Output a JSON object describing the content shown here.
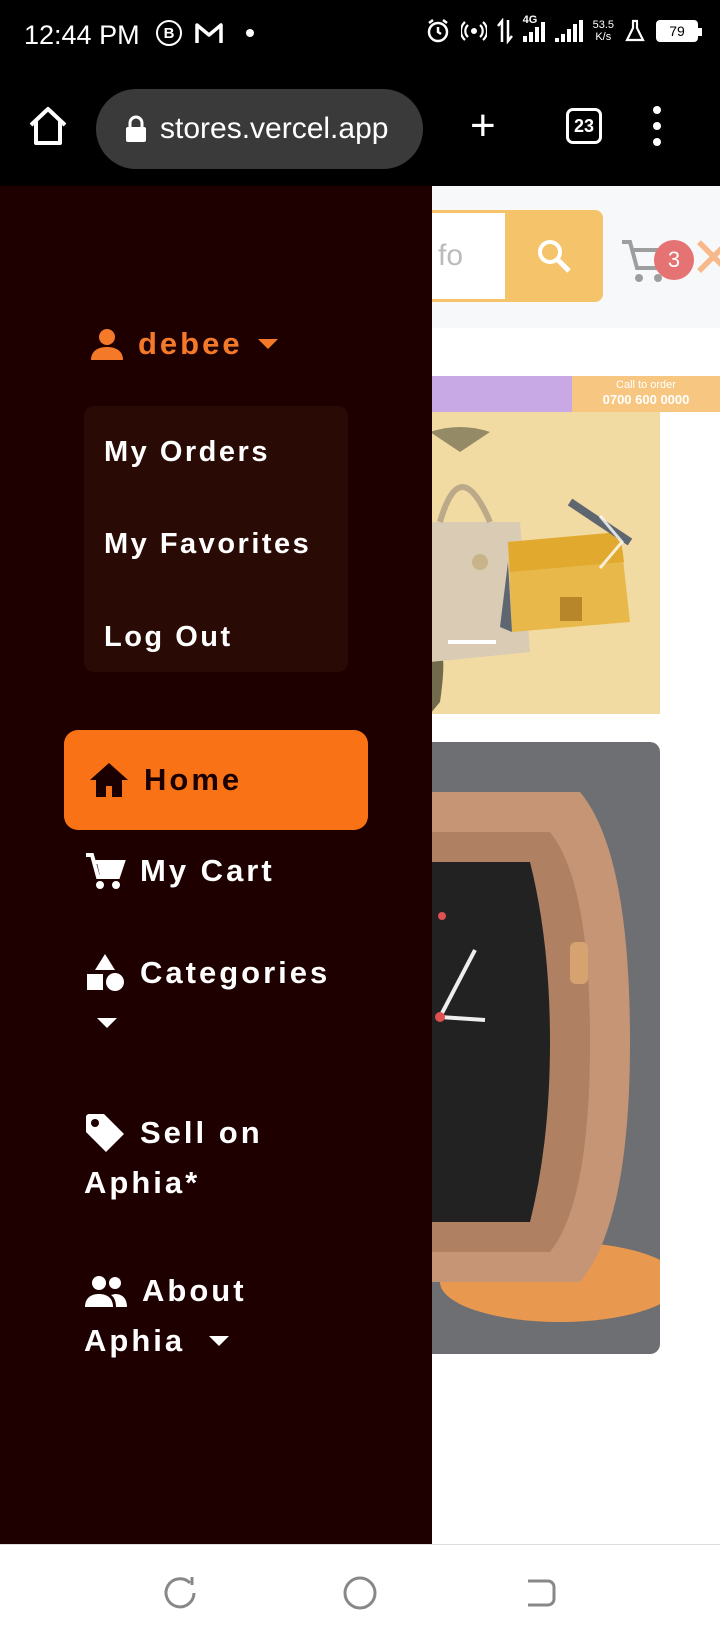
{
  "status_bar": {
    "time": "12:44 PM",
    "speed_value": "53.5",
    "speed_unit": "K/s",
    "network": "4G",
    "battery": "79"
  },
  "browser": {
    "url": "stores.vercel.app",
    "tab_count": "23"
  },
  "header": {
    "search_placeholder": "fo",
    "cart_count": "3"
  },
  "promo": {
    "call_label": "Call to order",
    "phone": "0700 600 0000"
  },
  "drawer": {
    "username": "debee",
    "user_menu": [
      "My Orders",
      "My Favorites",
      "Log Out"
    ],
    "nav": {
      "home": "Home",
      "cart": "My Cart",
      "categories": "Categories",
      "sell_line1": "Sell on",
      "sell_line2": "Aphia*",
      "about_line1": "About",
      "about_line2": "Aphia"
    }
  },
  "colors": {
    "accent": "#f97316",
    "drawer_bg": "#1e0000",
    "username": "#f47a2a"
  }
}
